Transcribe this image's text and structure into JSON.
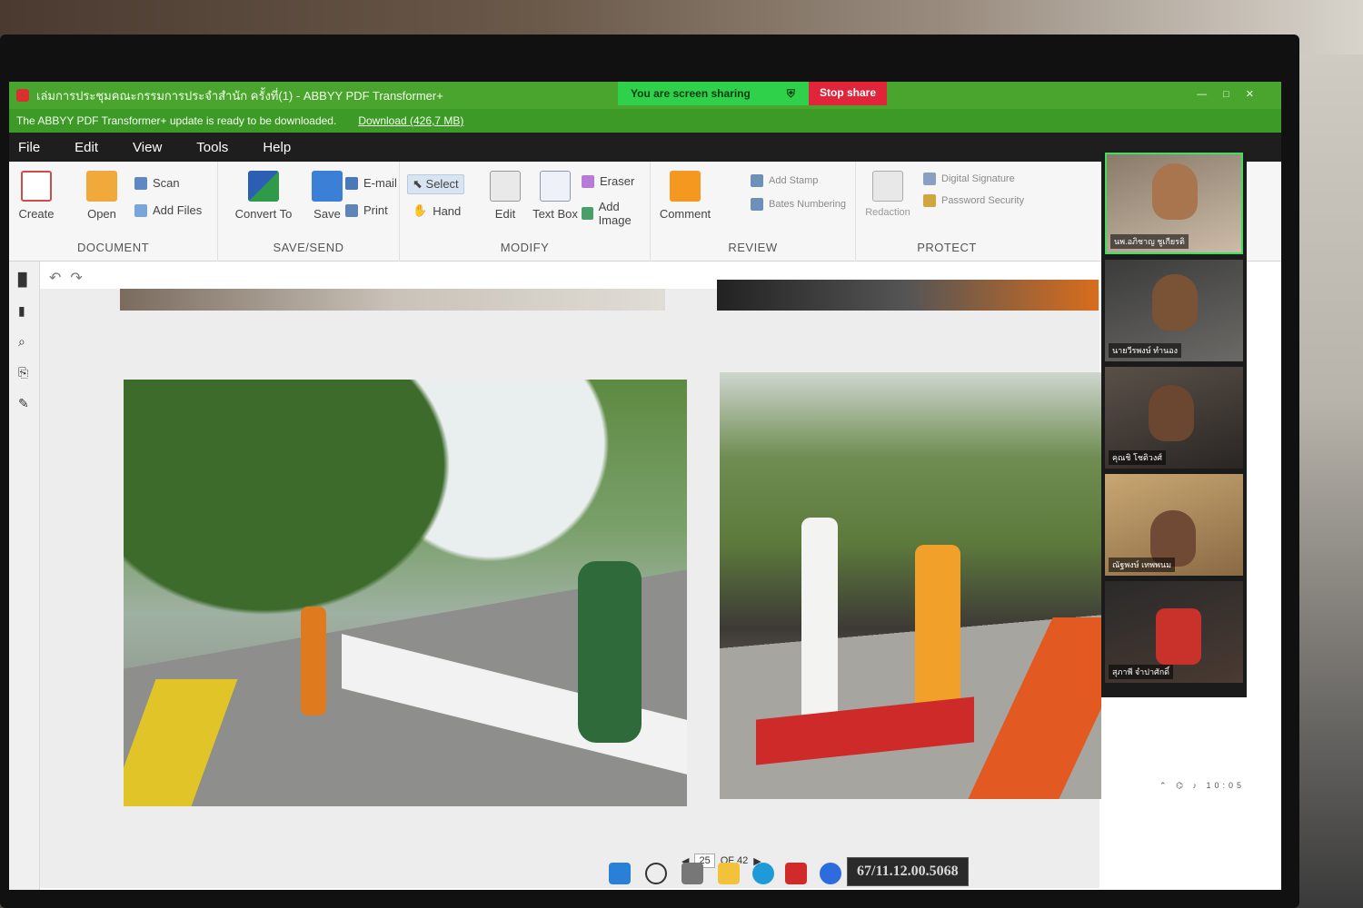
{
  "window": {
    "title": "เล่มการประชุมคณะกรรมการประจำสำนัก ครั้งที่(1) - ABBYY PDF Transformer+",
    "sharing_text": "You are screen sharing",
    "stop_share": "Stop share"
  },
  "update_bar": {
    "message": "The ABBYY PDF Transformer+ update is ready to be downloaded.",
    "download_link": "Download (426,7 MB)"
  },
  "menu": [
    "File",
    "Edit",
    "View",
    "Tools",
    "Help"
  ],
  "ribbon": {
    "document": {
      "label": "DOCUMENT",
      "create": "Create",
      "open": "Open",
      "scan": "Scan",
      "add_files": "Add Files"
    },
    "save_send": {
      "label": "SAVE/SEND",
      "convert_to": "Convert To",
      "save": "Save",
      "email": "E-mail",
      "print": "Print"
    },
    "modify": {
      "label": "MODIFY",
      "select": "Select",
      "hand": "Hand",
      "edit": "Edit",
      "text_box": "Text Box",
      "eraser": "Eraser",
      "add_image": "Add Image"
    },
    "review": {
      "label": "REVIEW",
      "comment": "Comment",
      "add_stamp": "Add Stamp",
      "bates_numbering": "Bates Numbering"
    },
    "protect": {
      "label": "PROTECT",
      "redaction": "Redaction",
      "digital_signature": "Digital Signature",
      "password_security": "Password Security"
    }
  },
  "participants": [
    {
      "name": "นพ.อภิชาญ ชูเกียรติ"
    },
    {
      "name": "นายวีรพงษ์ ทำนอง"
    },
    {
      "name": "คุณชิ โชติวงศ์"
    },
    {
      "name": "ณัฐพงษ์ เทพพนม"
    },
    {
      "name": "สุภาพี จำปาศักดิ์"
    }
  ],
  "page_nav": {
    "current": "25",
    "of": "OF 42"
  },
  "tray": {
    "clock": "10:05"
  },
  "sticker": {
    "asset_id": "67/11.12.00.5068"
  },
  "colors": {
    "title_green": "#4aa52e",
    "menu_bg": "#1e1e1e",
    "share_green": "#2fd04a",
    "stop_red": "#e0243a"
  }
}
